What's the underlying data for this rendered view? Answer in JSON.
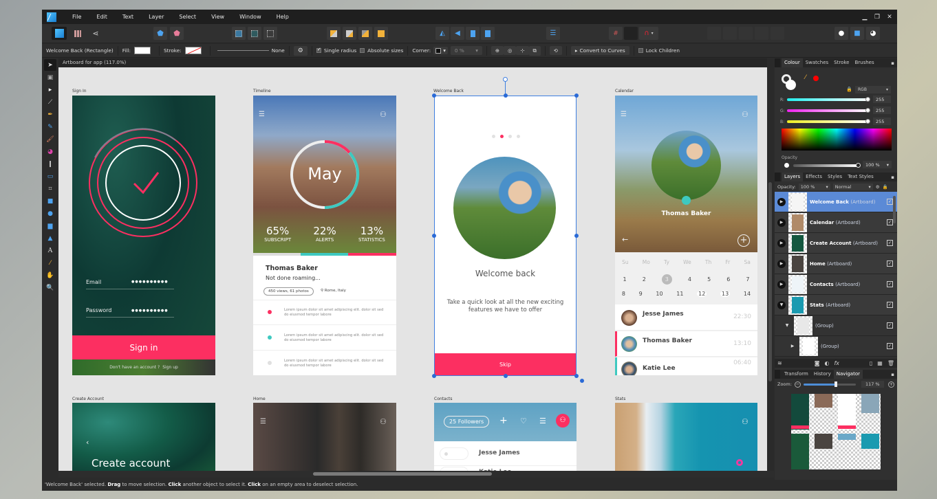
{
  "menubar": {
    "items": [
      "File",
      "Edit",
      "Text",
      "Layer",
      "Select",
      "View",
      "Window",
      "Help"
    ],
    "window_controls": [
      "minimize",
      "restore",
      "close"
    ]
  },
  "context_toolbar": {
    "selection": "Welcome Back (Rectangle)",
    "fill_label": "Fill:",
    "stroke_label": "Stroke:",
    "stroke_width_value": "None",
    "single_radius_label": "Single radius",
    "single_radius_checked": true,
    "absolute_sizes_label": "Absolute sizes",
    "absolute_sizes_checked": false,
    "corner_label": "Corner:",
    "corner_value": "0 %",
    "convert_to_curves_label": "Convert to Curves",
    "lock_children_label": "Lock Children",
    "lock_children_checked": false
  },
  "document_tab": "Artboard for app (117.0%)",
  "tools": [
    "move-tool",
    "artboard-tool",
    "node-tool",
    "corner-tool",
    "pen-tool",
    "pencil-tool",
    "vector-brush-tool",
    "fill-tool",
    "transparency-tool",
    "place-image-tool",
    "crop-tool",
    "rectangle-tool",
    "ellipse-tool",
    "rounded-rectangle-tool",
    "triangle-tool",
    "artistic-text-tool",
    "color-picker-tool",
    "view-tool",
    "zoom-tool"
  ],
  "artboards": {
    "sign_in": {
      "label": "Sign In",
      "email_label": "Email",
      "email_value": "●●●●●●●●●●",
      "password_label": "Password",
      "password_value": "●●●●●●●●●●",
      "button": "Sign in",
      "footer_question": "Don't have an account ?",
      "footer_link": "Sign up"
    },
    "timeline": {
      "label": "Timeline",
      "month": "May",
      "stats": [
        {
          "value": "65%",
          "label": "SUBSCRIPT"
        },
        {
          "value": "22%",
          "label": "ALERTS"
        },
        {
          "value": "13%",
          "label": "STATISTICS"
        }
      ],
      "name": "Thomas Baker",
      "status": "Not done roaming...",
      "views": "450 views, 61 photos",
      "location": "Rome, Italy",
      "items": [
        {
          "text": "Lorem ipsum dolor sit amet adipiscing elit. dolor sit sed do eiusmod tempor  labore",
          "color": "#fc2f61"
        },
        {
          "text": "Lorem ipsum dolor sit amet adipiscing elit. dolor sit sed do eiusmod tempor  labore",
          "color": "#3ec9c0"
        },
        {
          "text": "Lorem ipsum dolor sit amet adipiscing elit. dolor sit sed do eiusmod tempor  labore",
          "color": "#e0e0e0"
        }
      ]
    },
    "welcome_back": {
      "label": "Welcome Back",
      "title": "Welcome back",
      "subtitle": "Take a quick look at all the new exciting features we have to offer",
      "button": "Skip",
      "page_count": 4,
      "active_page": 2
    },
    "calendar": {
      "label": "Calendar",
      "name": "Thomas Baker",
      "weekdays": [
        "Su",
        "Mo",
        "Ty",
        "We",
        "Th",
        "Fr",
        "Sa"
      ],
      "week1": [
        "1",
        "2",
        "3",
        "4",
        "5",
        "6",
        "7"
      ],
      "week2": [
        "8",
        "9",
        "10",
        "11",
        "12",
        "13",
        "14"
      ],
      "selected_day": "3",
      "contacts": [
        {
          "name": "Jesse James",
          "time": "22:30",
          "accent": ""
        },
        {
          "name": "Thomas Baker",
          "time": "13:10",
          "accent": "#fc2f61"
        },
        {
          "name": "Katie Lee",
          "time": "06:40",
          "accent": "#3ec9c0"
        }
      ]
    },
    "create_account": {
      "label": "Create Account",
      "title": "Create account"
    },
    "home": {
      "label": "Home"
    },
    "contacts": {
      "label": "Contacts",
      "followers": "25 Followers",
      "people": [
        "Jesse James",
        "Katie Lee"
      ]
    },
    "stats": {
      "label": "Stats"
    }
  },
  "colour_panel": {
    "tabs": [
      "Colour",
      "Swatches",
      "Stroke",
      "Brushes"
    ],
    "active_tab": "Colour",
    "mode": "RGB",
    "r_label": "R:",
    "g_label": "G:",
    "b_label": "B:",
    "r": "255",
    "g": "255",
    "b": "255",
    "opacity_label": "Opacity",
    "opacity": "100 %",
    "picked_color": "#ff0000"
  },
  "layers_panel": {
    "tabs": [
      "Layers",
      "Effects",
      "Styles",
      "Text Styles"
    ],
    "active_tab": "Layers",
    "opacity_label": "Opacity:",
    "opacity": "100 %",
    "blend_mode": "Normal",
    "layers": [
      {
        "name": "Welcome Back",
        "type": "(Artboard)",
        "selected": true,
        "expanded": false,
        "indent": 0
      },
      {
        "name": "Calendar",
        "type": "(Artboard)",
        "selected": false,
        "expanded": false,
        "indent": 0
      },
      {
        "name": "Create Account",
        "type": "(Artboard)",
        "selected": false,
        "expanded": false,
        "indent": 0
      },
      {
        "name": "Home",
        "type": "(Artboard)",
        "selected": false,
        "expanded": false,
        "indent": 0
      },
      {
        "name": "Contacts",
        "type": "(Artboard)",
        "selected": false,
        "expanded": false,
        "indent": 0
      },
      {
        "name": "Stats",
        "type": "(Artboard)",
        "selected": false,
        "expanded": true,
        "indent": 0
      },
      {
        "name": "",
        "type": "(Group)",
        "selected": false,
        "expanded": true,
        "indent": 1
      },
      {
        "name": "",
        "type": "(Group)",
        "selected": false,
        "expanded": false,
        "indent": 2
      }
    ]
  },
  "navigator_panel": {
    "tabs": [
      "Transform",
      "History",
      "Navigator"
    ],
    "active_tab": "Navigator",
    "zoom_label": "Zoom:",
    "zoom_value": "117 %",
    "zoom_fraction": 0.62
  },
  "status_bar": {
    "prefix": "'Welcome Back' selected. ",
    "b1": "Drag",
    "t1": " to move selection. ",
    "b2": "Click",
    "t2": " another object to select it. ",
    "b3": "Click",
    "t3": " on an empty area to deselect selection."
  }
}
